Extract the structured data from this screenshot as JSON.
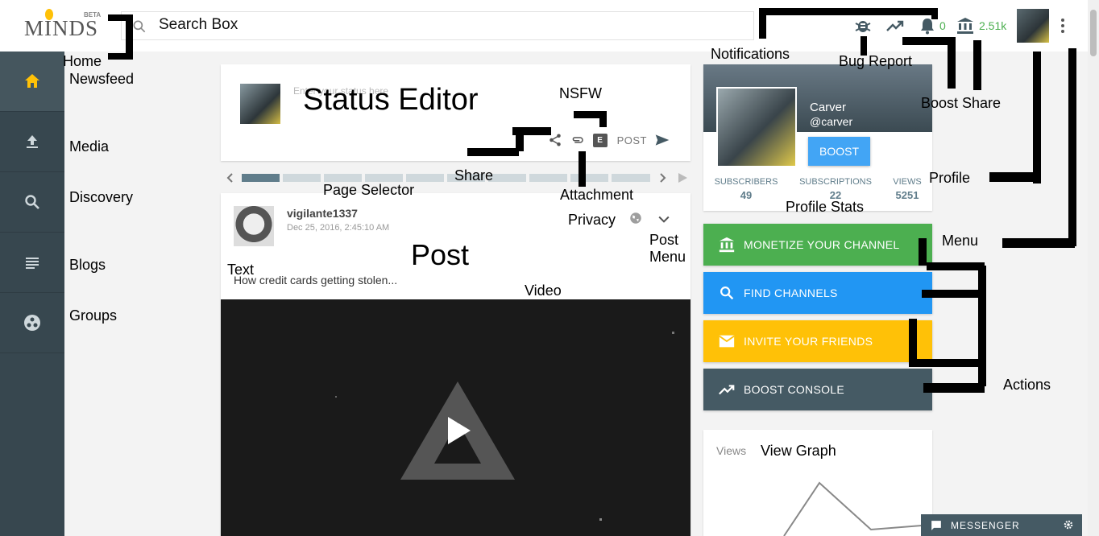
{
  "header": {
    "logo": "MINDS",
    "logo_badge": "BETA",
    "search_text": "Search Box",
    "notification_count": "0",
    "wallet_count": "2.51k"
  },
  "sidebar": {
    "items": [
      {
        "id": "newsfeed",
        "icon": "home-icon"
      },
      {
        "id": "media",
        "icon": "upload-icon"
      },
      {
        "id": "discovery",
        "icon": "search-icon"
      },
      {
        "id": "blogs",
        "icon": "list-icon"
      },
      {
        "id": "groups",
        "icon": "groups-icon"
      }
    ]
  },
  "annotations": {
    "home": "Home",
    "newsfeed": "Newsfeed",
    "media": "Media",
    "discovery": "Discovery",
    "blogs": "Blogs",
    "groups": "Groups",
    "status_editor": "Status Editor",
    "nsfw": "NSFW",
    "share": "Share",
    "page_selector": "Page Selector",
    "attachment": "Attachment",
    "privacy": "Privacy",
    "post_menu": "Post\nMenu",
    "text": "Text",
    "post": "Post",
    "video": "Video",
    "notifications": "Notifications",
    "bug_report": "Bug Report",
    "boost_share": "Boost Share",
    "profile": "Profile",
    "profile_stats": "Profile Stats",
    "menu": "Menu",
    "actions": "Actions",
    "view_graph": "View Graph"
  },
  "status_editor": {
    "placeholder": "Enter your status here",
    "post_label": "POST",
    "nsfw_badge": "E"
  },
  "post": {
    "username": "vigilante1337",
    "date": "Dec 25, 2016, 2:45:10 AM",
    "text": "How credit cards getting stolen..."
  },
  "profile": {
    "name": "Carver",
    "handle": "@carver",
    "boost_label": "BOOST",
    "stats": [
      {
        "label": "SUBSCRIBERS",
        "value": "49"
      },
      {
        "label": "SUBSCRIPTIONS",
        "value": "22"
      },
      {
        "label": "VIEWS",
        "value": "5251"
      }
    ]
  },
  "actions": [
    {
      "label": "MONETIZE YOUR CHANNEL",
      "color": "#4caf50",
      "icon": "bank-icon"
    },
    {
      "label": "FIND CHANNELS",
      "color": "#2196f3",
      "icon": "search-icon"
    },
    {
      "label": "INVITE YOUR FRIENDS",
      "color": "#ffc107",
      "icon": "mail-icon"
    },
    {
      "label": "BOOST CONSOLE",
      "color": "#455a64",
      "icon": "trending-icon"
    }
  ],
  "graph": {
    "views_label": "Views"
  },
  "messenger": {
    "label": "MESSENGER"
  },
  "colors": {
    "sidebar": "#37474f",
    "accent_green": "#4caf50",
    "accent_blue": "#2196f3",
    "accent_yellow": "#ffc107",
    "slate": "#455a64"
  }
}
